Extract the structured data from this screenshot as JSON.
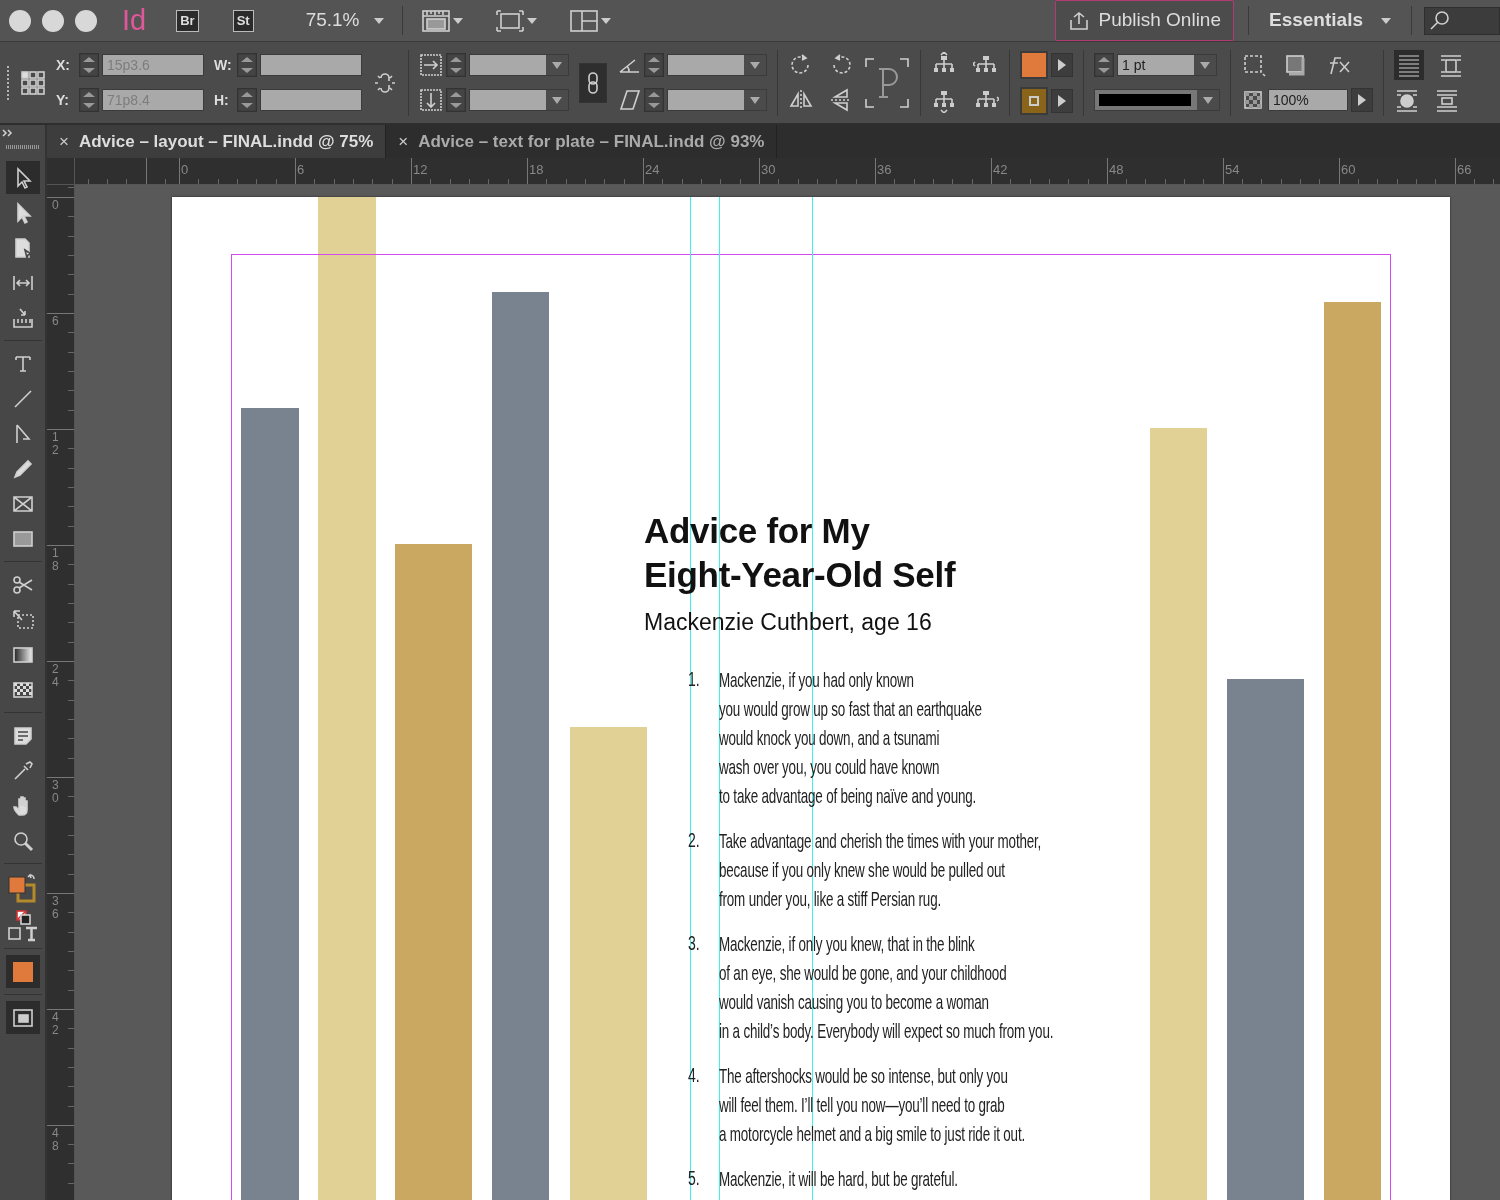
{
  "window": {
    "logo": "Id",
    "app_badges": [
      "Br",
      "St"
    ],
    "zoom": "75.1%",
    "publish_button": "Publish Online",
    "workspace": "Essentials"
  },
  "control_bar": {
    "x_label": "X:",
    "x_value": "15p3.6",
    "y_label": "Y:",
    "y_value": "71p8.4",
    "w_label": "W:",
    "h_label": "H:",
    "stroke_weight": "1 pt",
    "opacity": "100%"
  },
  "tabs": [
    {
      "label": "Advice – layout – FINAL.indd @ 75%",
      "close": "×",
      "selected": true
    },
    {
      "label": "Advice – text for plate – FINAL.indd @ 93%",
      "close": "×",
      "selected": false
    }
  ],
  "ruler": {
    "horizontal": [
      "0",
      "6",
      "12",
      "18",
      "24",
      "30",
      "36",
      "42",
      "48",
      "54",
      "60",
      "66"
    ],
    "vertical": [
      "0",
      "6",
      "12",
      "18",
      "24",
      "30",
      "36",
      "42",
      "48"
    ]
  },
  "tools": [
    {
      "selected": true
    },
    {
      "selected": false
    },
    {
      "selected": false
    },
    {
      "selected": false
    },
    {
      "selected": false
    },
    {
      "selected": false
    },
    {
      "selected": false
    },
    {
      "selected": false
    },
    {
      "selected": false
    },
    {
      "selected": false
    },
    {
      "selected": false
    },
    {
      "selected": false
    },
    {
      "selected": false
    },
    {
      "selected": false
    },
    {
      "selected": false
    },
    {
      "selected": false
    },
    {
      "selected": false
    },
    {
      "selected": false
    },
    {
      "selected": false
    }
  ],
  "document": {
    "bars": [
      {
        "color": "#79828f"
      },
      {
        "color": "#e2d195"
      },
      {
        "color": "#cba862"
      },
      {
        "color": "#79828f"
      },
      {
        "color": "#e2d195"
      },
      {
        "color": "#e2d195"
      },
      {
        "color": "#79828f"
      },
      {
        "color": "#cba862"
      }
    ],
    "title_lines": [
      "Advice for My",
      "Eight-Year-Old Self"
    ],
    "byline": "Mackenzie Cuthbert, age 16",
    "items": [
      {
        "number": "1.",
        "lines": [
          "Mackenzie, if you had only known",
          "you would grow up so fast that an earthquake",
          "would knock you down, and a tsunami",
          "wash over you, you could have known",
          "to take advantage of being naïve and young."
        ]
      },
      {
        "number": "2.",
        "lines": [
          "Take advantage and cherish the times with your mother,",
          "because if you only knew she would be pulled out",
          "from under you, like a stiff Persian rug."
        ]
      },
      {
        "number": "3.",
        "lines": [
          "Mackenzie, if only you knew, that in the blink",
          "of an eye, she would be gone, and your childhood",
          "would vanish causing you to become a woman",
          "in a child’s body. Everybody will expect so much from you."
        ]
      },
      {
        "number": "4.",
        "lines": [
          "The aftershocks would be so intense, but only you",
          "will feel them. I’ll tell you now—you’ll need to grab",
          "a motorcycle helmet and a big smile to just ride it out."
        ]
      },
      {
        "number": "5.",
        "lines": [
          "Mackenzie, it will be hard, but be grateful."
        ]
      }
    ]
  }
}
